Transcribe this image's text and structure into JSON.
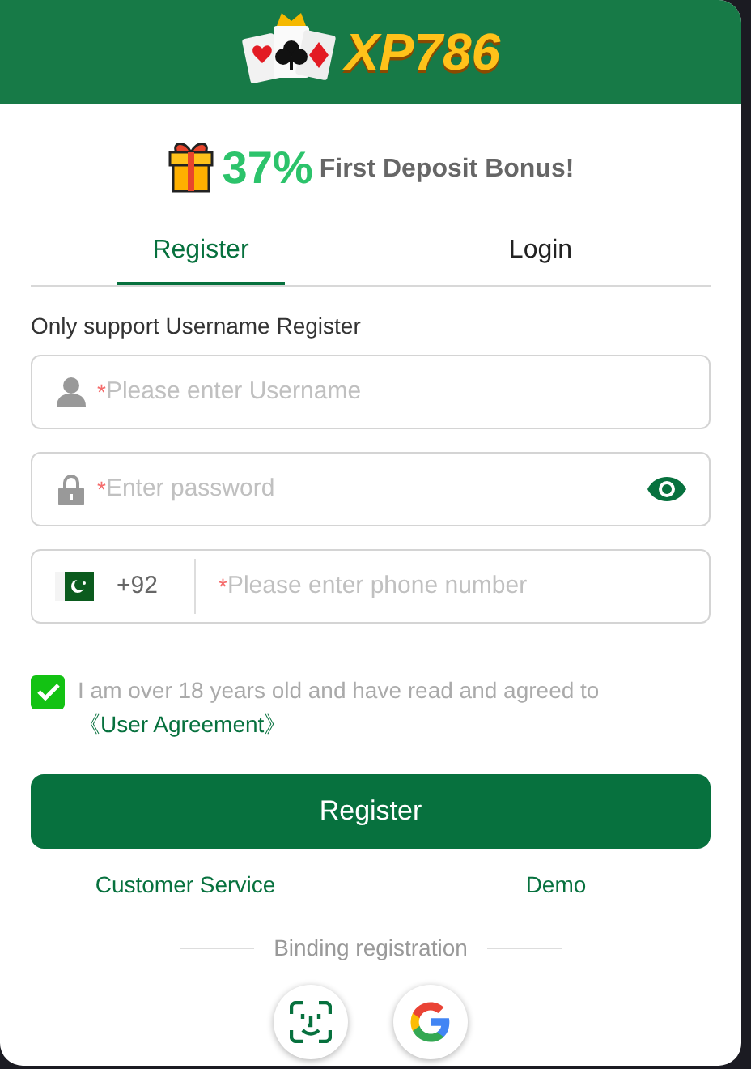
{
  "header": {
    "logo_text": "XP786"
  },
  "bonus": {
    "percent": "37%",
    "text": "First Deposit Bonus!"
  },
  "tabs": [
    {
      "label": "Register",
      "selected": true
    },
    {
      "label": "Login",
      "selected": false
    }
  ],
  "note": "Only support Username Register",
  "fields": [
    {
      "kind": "username",
      "mark": "*",
      "placeholder": "Please enter Username"
    },
    {
      "kind": "password",
      "mark": "*",
      "placeholder": "Enter password"
    },
    {
      "kind": "phone",
      "code": "+92",
      "mark": "*",
      "placeholder": "Please enter phone number"
    }
  ],
  "agreement": {
    "checked": true,
    "text": "I am over 18 years old and have read and agreed to",
    "link": "《User Agreement》"
  },
  "submit": "Register",
  "links": [
    "Customer Service",
    "Demo"
  ],
  "binding": {
    "title": "Binding registration",
    "options": [
      {
        "kind": "face"
      },
      {
        "kind": "google"
      }
    ]
  }
}
